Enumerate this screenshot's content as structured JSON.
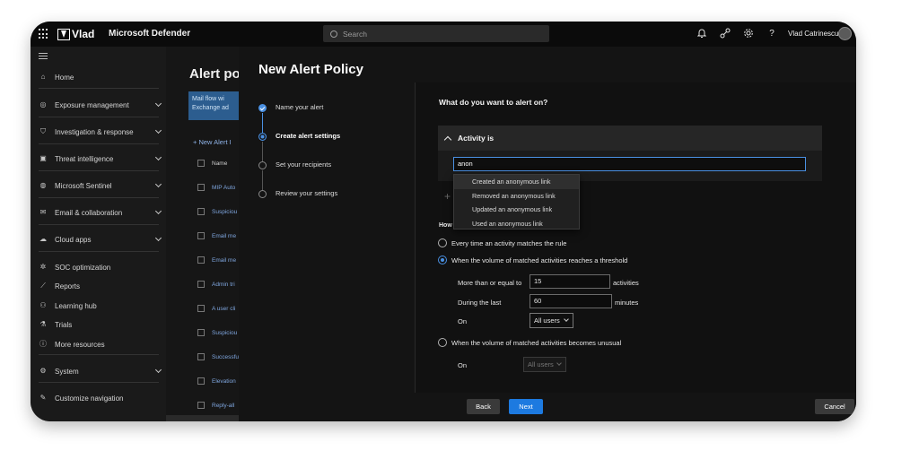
{
  "topbar": {
    "logo_text": "Vlad",
    "app_name": "Microsoft Defender",
    "search_placeholder": "Search",
    "user_name": "Vlad Catrinescu"
  },
  "sidebar": {
    "items": [
      {
        "label": "Home",
        "icon": "home-icon"
      },
      {
        "label": "Exposure management",
        "icon": "exposure-icon"
      },
      {
        "label": "Investigation & response",
        "icon": "shield-icon"
      },
      {
        "label": "Threat intelligence",
        "icon": "threat-icon"
      },
      {
        "label": "Microsoft Sentinel",
        "icon": "sentinel-icon"
      },
      {
        "label": "Email & collaboration",
        "icon": "mail-icon"
      },
      {
        "label": "Cloud apps",
        "icon": "cloud-icon"
      },
      {
        "label": "SOC optimization",
        "icon": "soc-icon"
      },
      {
        "label": "Reports",
        "icon": "chart-icon"
      },
      {
        "label": "Learning hub",
        "icon": "learning-icon"
      },
      {
        "label": "Trials",
        "icon": "trials-icon"
      },
      {
        "label": "More resources",
        "icon": "info-icon"
      },
      {
        "label": "System",
        "icon": "gear-icon"
      },
      {
        "label": "Customize navigation",
        "icon": "pencil-icon"
      }
    ]
  },
  "background_page": {
    "title": "Alert po",
    "banner_line1": "Mail flow wi",
    "banner_line2": "Exchange ad",
    "new_alert": "New Alert I",
    "column_name": "Name",
    "rows": [
      "MIP Auto",
      "Suspiciou",
      "Email me",
      "Email me",
      "Admin tri",
      "A user cli",
      "Suspiciou",
      "Successfu",
      "Elevation",
      "Reply-all"
    ]
  },
  "panel": {
    "title": "New Alert Policy",
    "steps": [
      {
        "label": "Name your alert",
        "state": "done"
      },
      {
        "label": "Create alert settings",
        "state": "active"
      },
      {
        "label": "Set your recipients",
        "state": "pending"
      },
      {
        "label": "Review your settings",
        "state": "pending"
      }
    ],
    "question": "What do you want to alert on?",
    "activity_header": "Activity is",
    "activity_input": "anon",
    "dropdown_options": [
      "Created an anonymous link",
      "Removed an anonymous link",
      "Updated an anonymous link",
      "Used an anonymous link"
    ],
    "how_label": "How",
    "radio_every": "Every time an activity matches the rule",
    "radio_threshold": "When the volume of matched activities reaches a threshold",
    "more_than_label": "More than or equal to",
    "more_than_value": "15",
    "activities_unit": "activities",
    "during_label": "During the last",
    "during_value": "60",
    "minutes_unit": "minutes",
    "on_label": "On",
    "on_value": "All users",
    "radio_unusual": "When the volume of matched activities becomes unusual",
    "on2_label": "On",
    "on2_value": "All users"
  },
  "footer": {
    "back": "Back",
    "next": "Next",
    "cancel": "Cancel"
  },
  "colors": {
    "accent": "#1d7ae0",
    "background": "#141414"
  }
}
